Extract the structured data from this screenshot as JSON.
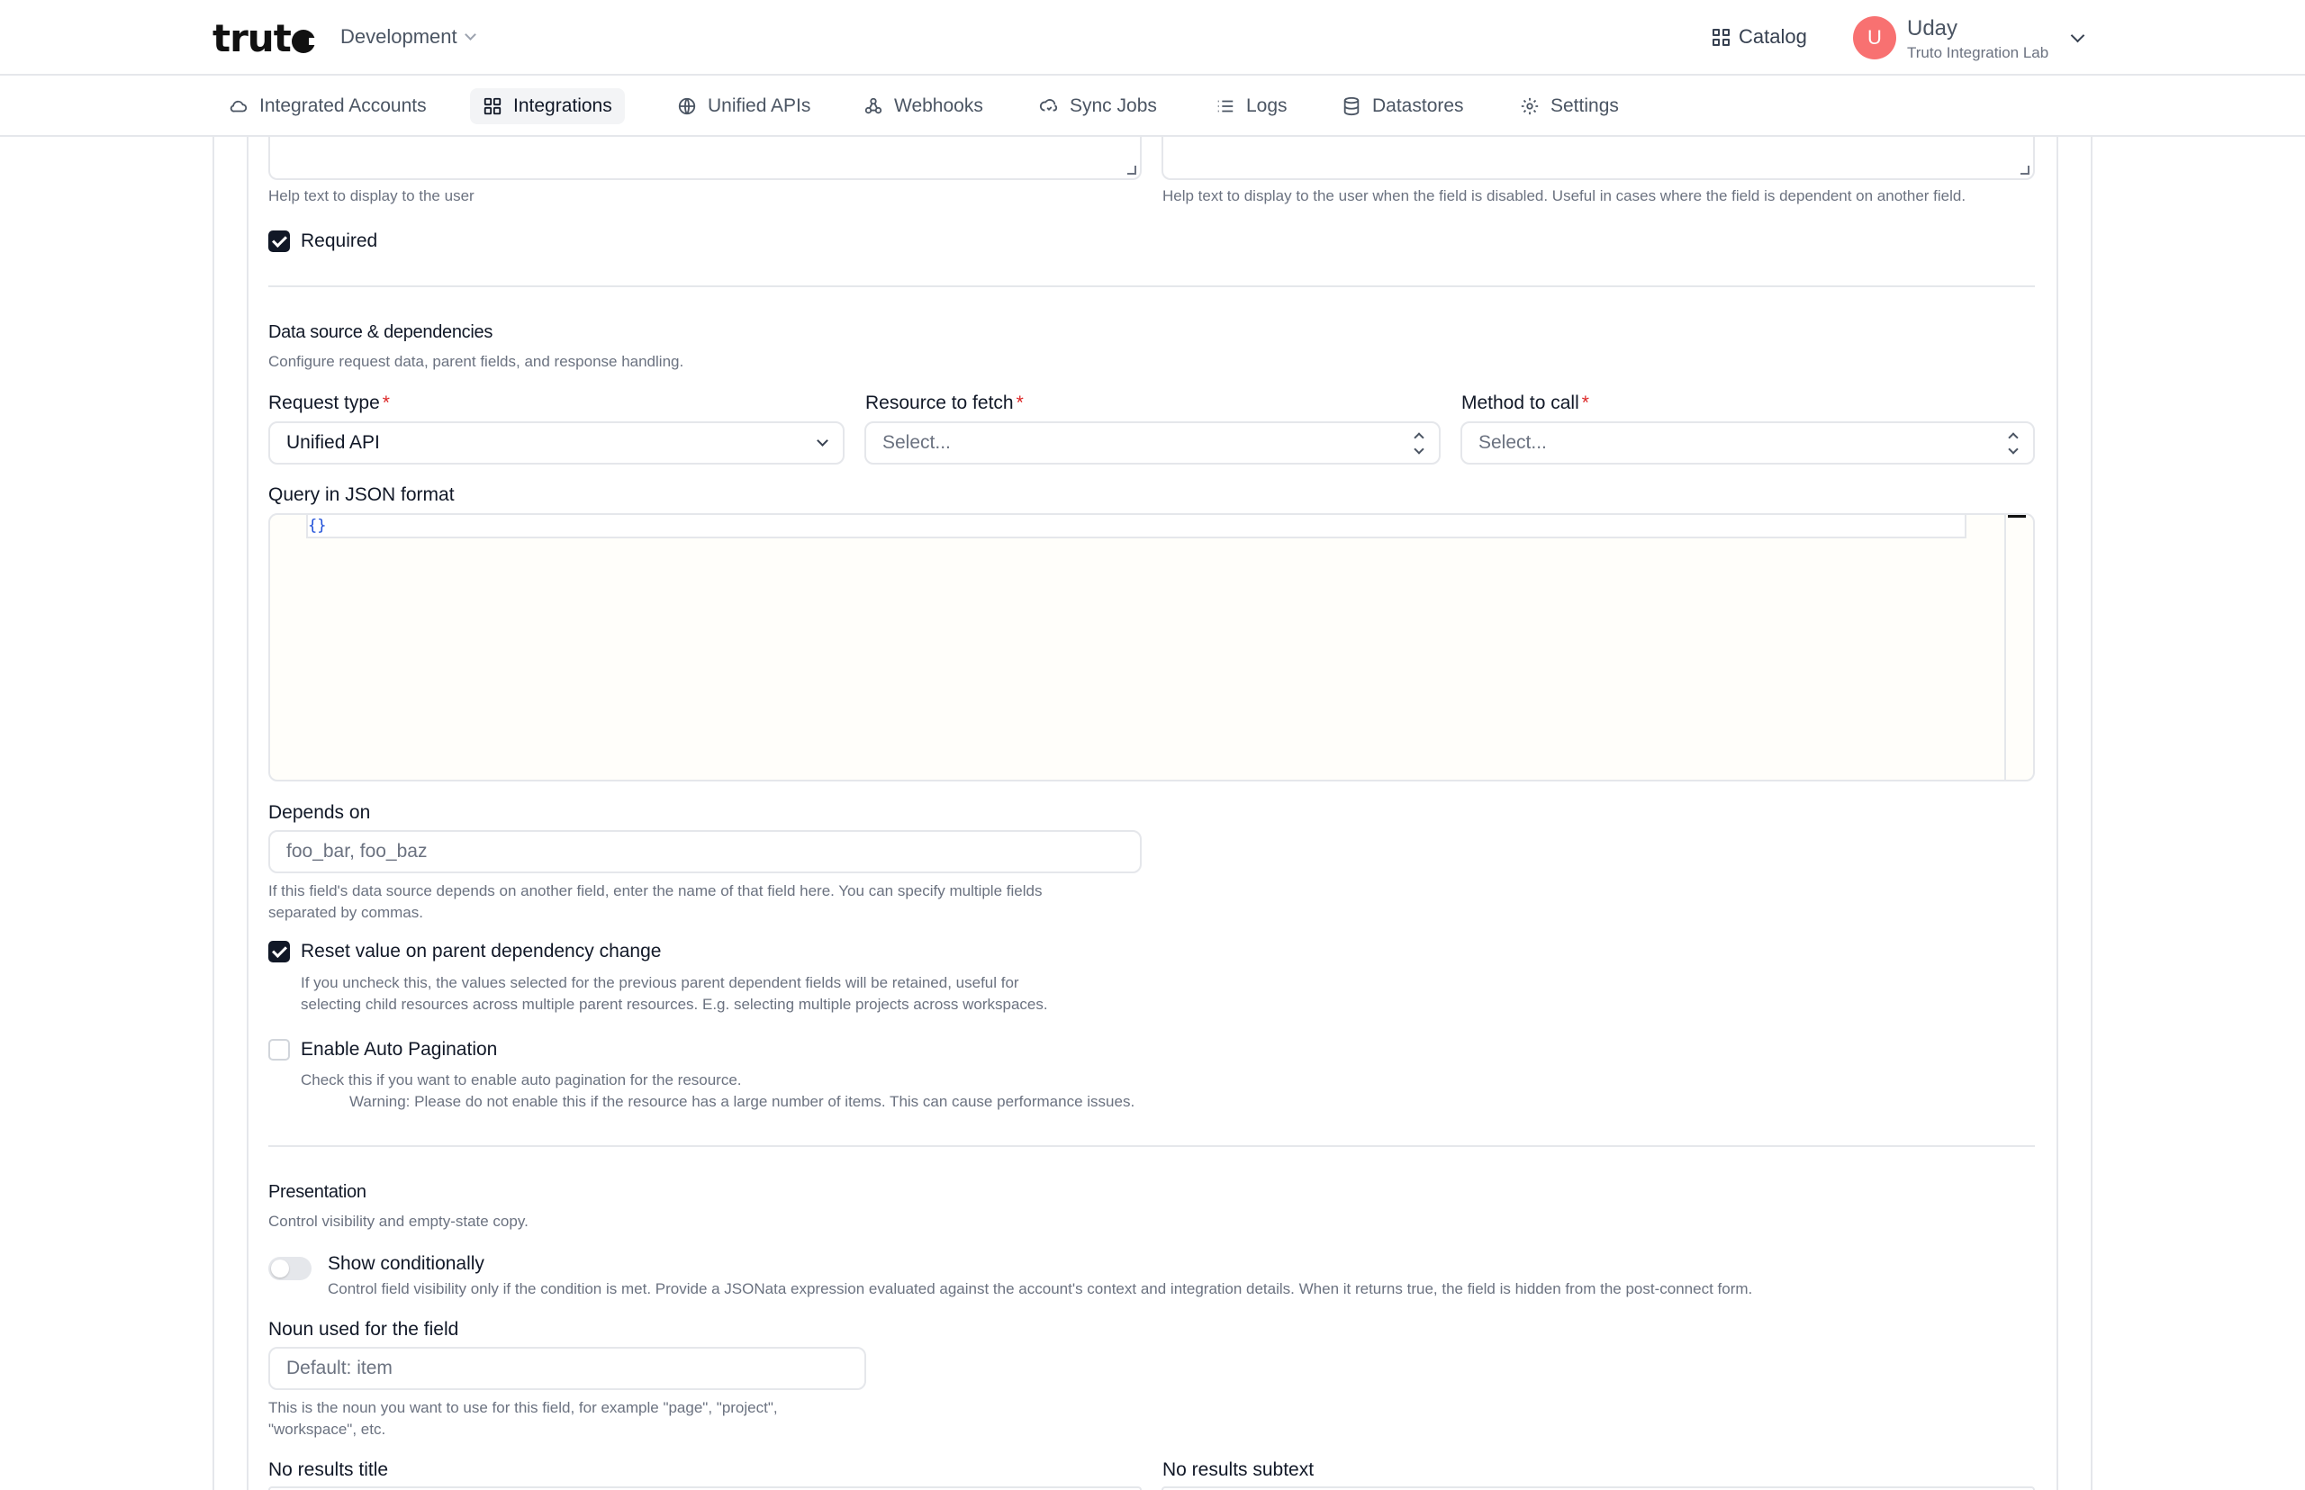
{
  "header": {
    "logo_text": "truto",
    "environment": "Development",
    "catalog_label": "Catalog",
    "user": {
      "initial": "U",
      "name": "Uday",
      "org": "Truto Integration Lab"
    }
  },
  "nav": {
    "items": [
      {
        "label": "Integrated Accounts",
        "icon": "cloud-icon",
        "active": false
      },
      {
        "label": "Integrations",
        "icon": "grid-icon",
        "active": true
      },
      {
        "label": "Unified APIs",
        "icon": "globe-icon",
        "active": false
      },
      {
        "label": "Webhooks",
        "icon": "webhook-icon",
        "active": false
      },
      {
        "label": "Sync Jobs",
        "icon": "sync-icon",
        "active": false
      },
      {
        "label": "Logs",
        "icon": "list-icon",
        "active": false
      },
      {
        "label": "Datastores",
        "icon": "database-icon",
        "active": false
      },
      {
        "label": "Settings",
        "icon": "gear-icon",
        "active": false
      }
    ]
  },
  "field_top": {
    "help_left": "Help text to display to the user",
    "help_right": "Help text to display to the user when the field is disabled. Useful in cases where the field is dependent on another field.",
    "required_label": "Required",
    "required_checked": true
  },
  "data_source": {
    "title": "Data source & dependencies",
    "subtitle": "Configure request data, parent fields, and response handling.",
    "request_type_label": "Request type",
    "request_type_value": "Unified API",
    "resource_label": "Resource to fetch",
    "resource_placeholder": "Select...",
    "method_label": "Method to call",
    "method_placeholder": "Select...",
    "required_marker": "*",
    "query_label": "Query in JSON format",
    "query_value": "{}",
    "depends_on_label": "Depends on",
    "depends_on_placeholder": "foo_bar, foo_baz",
    "depends_on_help_1": "If this field's data source depends on another field, enter the name of that field here. You can specify multiple fields",
    "depends_on_help_2": "separated by commas.",
    "reset_label": "Reset value on parent dependency change",
    "reset_checked": true,
    "reset_help_1": "If you uncheck this, the values selected for the previous parent dependent fields will be retained, useful for",
    "reset_help_2": "selecting child resources across multiple parent resources. E.g. selecting multiple projects across workspaces.",
    "pagination_label": "Enable Auto Pagination",
    "pagination_checked": false,
    "pagination_help_1": "Check this if you want to enable auto pagination for the resource.",
    "pagination_help_2": "Warning: Please do not enable this if the resource has a large number of items. This can cause performance issues."
  },
  "presentation": {
    "title": "Presentation",
    "subtitle": "Control visibility and empty-state copy.",
    "show_conditionally_label": "Show conditionally",
    "show_conditionally_on": false,
    "show_conditionally_help": "Control field visibility only if the condition is met. Provide a JSONata expression evaluated against the account's context and integration details. When it returns true, the field is hidden from the post-connect form.",
    "noun_label": "Noun used for the field",
    "noun_placeholder": "Default: item",
    "noun_help_1": "This is the noun you want to use for this field, for example \"page\", \"project\",",
    "noun_help_2": "\"workspace\", etc.",
    "no_results_title_label": "No results title",
    "no_results_subtext_label": "No results subtext"
  }
}
